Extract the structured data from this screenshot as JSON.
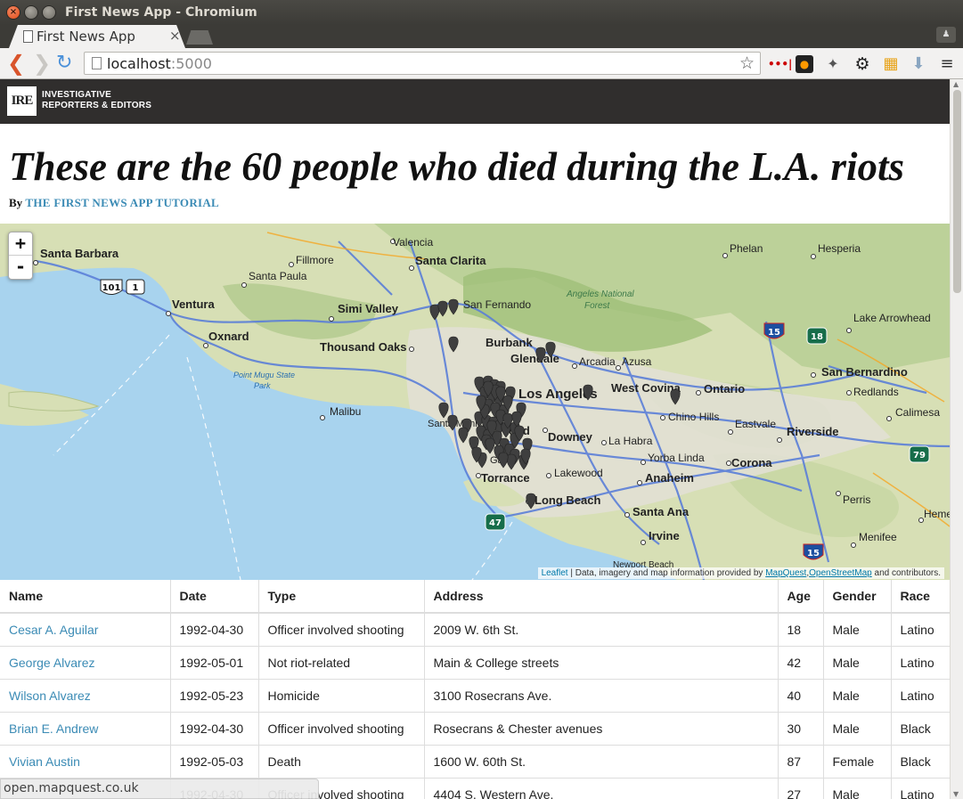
{
  "window": {
    "title": "First News App - Chromium"
  },
  "tab": {
    "title": "First News App",
    "close": "×"
  },
  "omnibox": {
    "host": "localhost",
    "port": ":5000"
  },
  "site": {
    "logo_mark": "IRE",
    "logo_line1": "INVESTIGATIVE",
    "logo_line2": "REPORTERS & EDITORS"
  },
  "article": {
    "headline": "These are the 60 people who died during the L.A. riots",
    "byline_prefix": "By ",
    "byline_link": "THE FIRST NEWS APP TUTORIAL"
  },
  "map": {
    "zoom_in": "+",
    "zoom_out": "-",
    "attribution_leaflet": "Leaflet",
    "attribution_text": " | Data, imagery and map information provided by ",
    "attribution_mapquest": "MapQuest",
    "attribution_osm": "OpenStreetMap",
    "attribution_tail": " and contributors.",
    "places": [
      "Valencia",
      "Santa Barbara",
      "Fillmore",
      "Santa Clarita",
      "Phelan",
      "Hesperia",
      "Santa Paula",
      "Ventura",
      "San Fernando",
      "Angeles National",
      "Forest",
      "Simi Valley",
      "Oxnard",
      "Thousand Oaks",
      "Burbank",
      "Glendale",
      "Lake Arrowhead",
      "Arcadia",
      "Azusa",
      "San Bernardino",
      "Point Mugu State",
      "Park",
      "Los Angeles",
      "West Covina",
      "Ontario",
      "Redlands",
      "Malibu",
      "Chino Hills",
      "Calimesa",
      "Downey",
      "La Habra",
      "Eastvale",
      "Riverside",
      "Yorba Linda",
      "Corona",
      "Torrance",
      "Lakewood",
      "Anaheim",
      "Long Beach",
      "Santa Ana",
      "Perris",
      "Irvine",
      "Menifee",
      "Newport Beach",
      "Hemet",
      "ood",
      "Santa Monica",
      "Ga"
    ],
    "shields": [
      "101",
      "1",
      "15",
      "18",
      "79",
      "47",
      "15"
    ]
  },
  "status_bubble": "open.mapquest.co.uk",
  "table": {
    "headers": [
      "Name",
      "Date",
      "Type",
      "Address",
      "Age",
      "Gender",
      "Race"
    ],
    "rows": [
      [
        "Cesar A. Aguilar",
        "1992-04-30",
        "Officer involved shooting",
        "2009 W. 6th St.",
        "18",
        "Male",
        "Latino"
      ],
      [
        "George Alvarez",
        "1992-05-01",
        "Not riot-related",
        "Main & College streets",
        "42",
        "Male",
        "Latino"
      ],
      [
        "Wilson Alvarez",
        "1992-05-23",
        "Homicide",
        "3100 Rosecrans Ave.",
        "40",
        "Male",
        "Latino"
      ],
      [
        "Brian E. Andrew",
        "1992-04-30",
        "Officer involved shooting",
        "Rosecrans & Chester avenues",
        "30",
        "Male",
        "Black"
      ],
      [
        "Vivian Austin",
        "1992-05-03",
        "Death",
        "1600 W. 60th St.",
        "87",
        "Female",
        "Black"
      ],
      [
        "",
        "1992-04-30",
        "Officer involved shooting",
        "4404 S. Western Ave.",
        "27",
        "Male",
        "Latino"
      ]
    ]
  }
}
